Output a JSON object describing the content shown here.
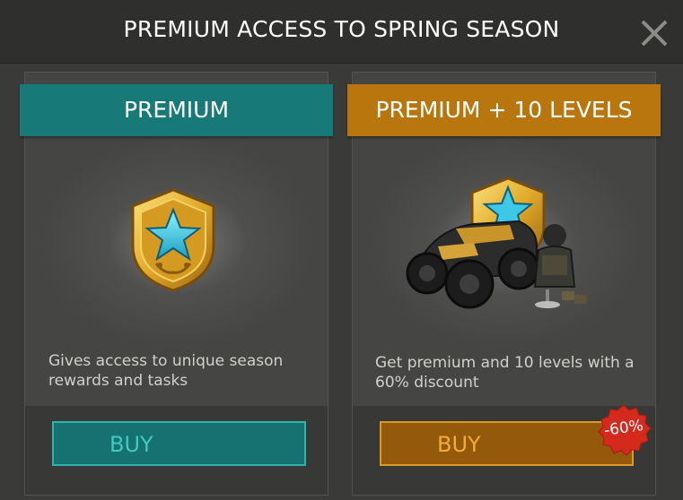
{
  "header": {
    "title": "PREMIUM ACCESS TO SPRING SEASON"
  },
  "offers": [
    {
      "name": "PREMIUM",
      "description": "Gives access to unique season rewards and tasks",
      "button": "BUY",
      "icon": "premium-badge-icon"
    },
    {
      "name": "PREMIUM + 10 LEVELS",
      "description": "Get premium and 10 levels with a 60% discount",
      "button": "BUY",
      "discount": "-60%",
      "icon": "vehicle-bundle-icon"
    }
  ],
  "colors": {
    "teal": "#177a78",
    "orange": "#b9760e",
    "discount_red": "#d42a1e"
  }
}
